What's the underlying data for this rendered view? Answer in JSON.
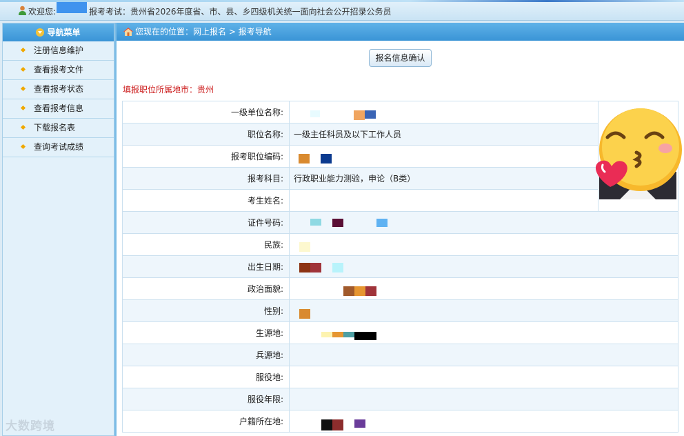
{
  "topbar": {
    "welcome_label": "欢迎您:",
    "exam_text": "报考考试：贵州省2026年度省、市、县、乡四级机关统一面向社会公开招录公务员"
  },
  "sidebar": {
    "title": "导航菜单",
    "items": [
      {
        "label": "注册信息维护"
      },
      {
        "label": "查看报考文件"
      },
      {
        "label": "查看报考状态"
      },
      {
        "label": "查看报考信息"
      },
      {
        "label": "下载报名表"
      },
      {
        "label": "查询考试成绩"
      }
    ]
  },
  "breadcrumb": {
    "text": "您现在的位置：网上报名 > 报考导航"
  },
  "confirm_button": "报名信息确认",
  "city_line": "填报职位所属地市：贵州",
  "form": {
    "rows": [
      {
        "label": "一级单位名称:",
        "value": ""
      },
      {
        "label": "职位名称:",
        "value": "一级主任科员及以下工作人员"
      },
      {
        "label": "报考职位编码:",
        "value": ""
      },
      {
        "label": "报考科目:",
        "value": "行政职业能力测验，申论（B类）"
      },
      {
        "label": "考生姓名:",
        "value": ""
      },
      {
        "label": "证件号码:",
        "value": ""
      },
      {
        "label": "民族:",
        "value": ""
      },
      {
        "label": "出生日期:",
        "value": ""
      },
      {
        "label": "政治面貌:",
        "value": ""
      },
      {
        "label": "性别:",
        "value": ""
      },
      {
        "label": "生源地:",
        "value": ""
      },
      {
        "label": "兵源地:",
        "value": ""
      },
      {
        "label": "服役地:",
        "value": ""
      },
      {
        "label": "服役年限:",
        "value": ""
      },
      {
        "label": "户籍所在地:",
        "value": ""
      }
    ]
  },
  "watermark": "大数跨境",
  "colors": {
    "header_blue": "#3a94d6",
    "alert_red": "#cc1b1b"
  },
  "icons": {
    "user": "user-icon",
    "home": "home-icon",
    "bullet": "diamond-bullet-icon",
    "menu": "chevron-down-icon",
    "photo_sticker": "kiss-emoji-icon"
  }
}
